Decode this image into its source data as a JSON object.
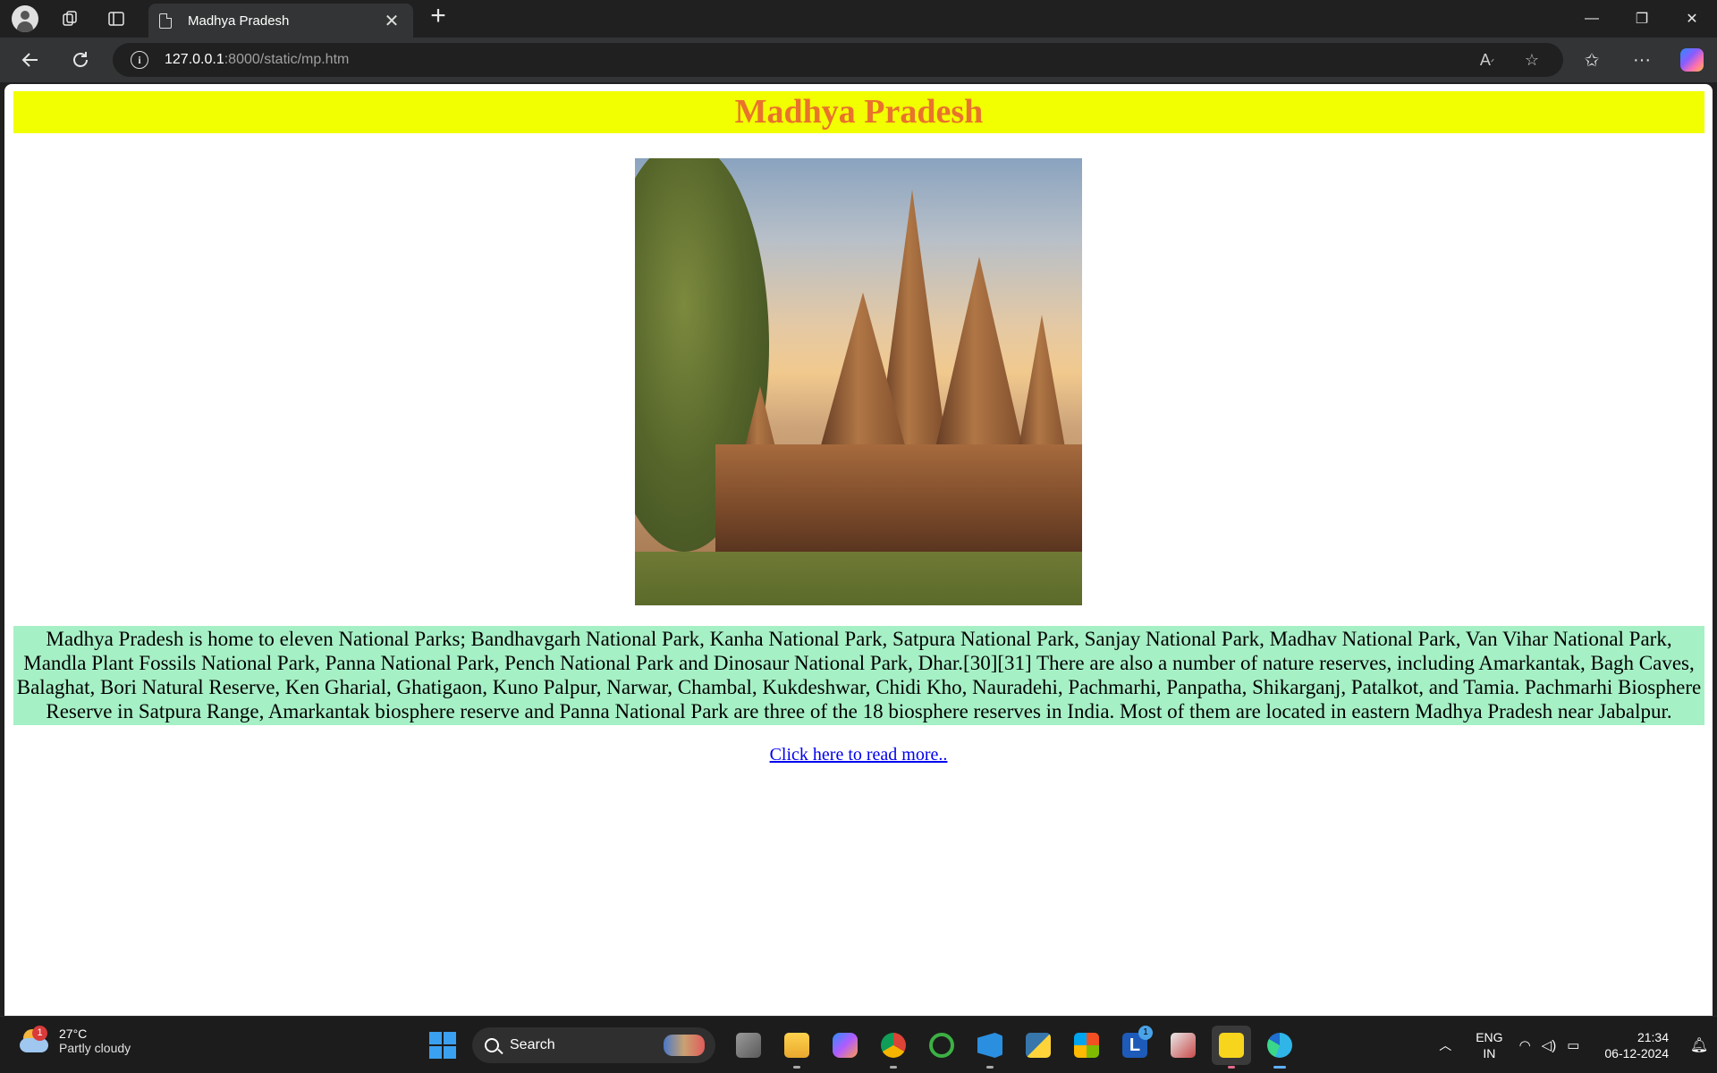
{
  "browser": {
    "tab_title": "Madhya Pradesh",
    "url_host": "127.0.0.1",
    "url_rest": ":8000/static/mp.htm"
  },
  "page": {
    "heading": "Madhya Pradesh",
    "paragraph": "Madhya Pradesh is home to eleven National Parks; Bandhavgarh National Park, Kanha National Park, Satpura National Park, Sanjay National Park, Madhav National Park, Van Vihar National Park, Mandla Plant Fossils National Park, Panna National Park, Pench National Park and Dinosaur National Park, Dhar.[30][31] There are also a number of nature reserves, including Amarkantak, Bagh Caves, Balaghat, Bori Natural Reserve, Ken Gharial, Ghatigaon, Kuno Palpur, Narwar, Chambal, Kukdeshwar, Chidi Kho, Nauradehi, Pachmarhi, Panpatha, Shikarganj, Patalkot, and Tamia. Pachmarhi Biosphere Reserve in Satpura Range, Amarkantak biosphere reserve and Panna National Park are three of the 18 biosphere reserves in India. Most of them are located in eastern Madhya Pradesh near Jabalpur.",
    "link_text": "Click here to read more..",
    "colors": {
      "heading_bg": "#f2ff00",
      "heading_text": "#e9722c",
      "paragraph_bg": "#a6f0c6"
    }
  },
  "taskbar": {
    "weather_badge": "1",
    "temperature": "27°C",
    "condition": "Partly cloudy",
    "search_placeholder": "Search",
    "lang_line1": "ENG",
    "lang_line2": "IN",
    "time": "21:34",
    "date": "06-12-2024",
    "app_badge": "1"
  }
}
